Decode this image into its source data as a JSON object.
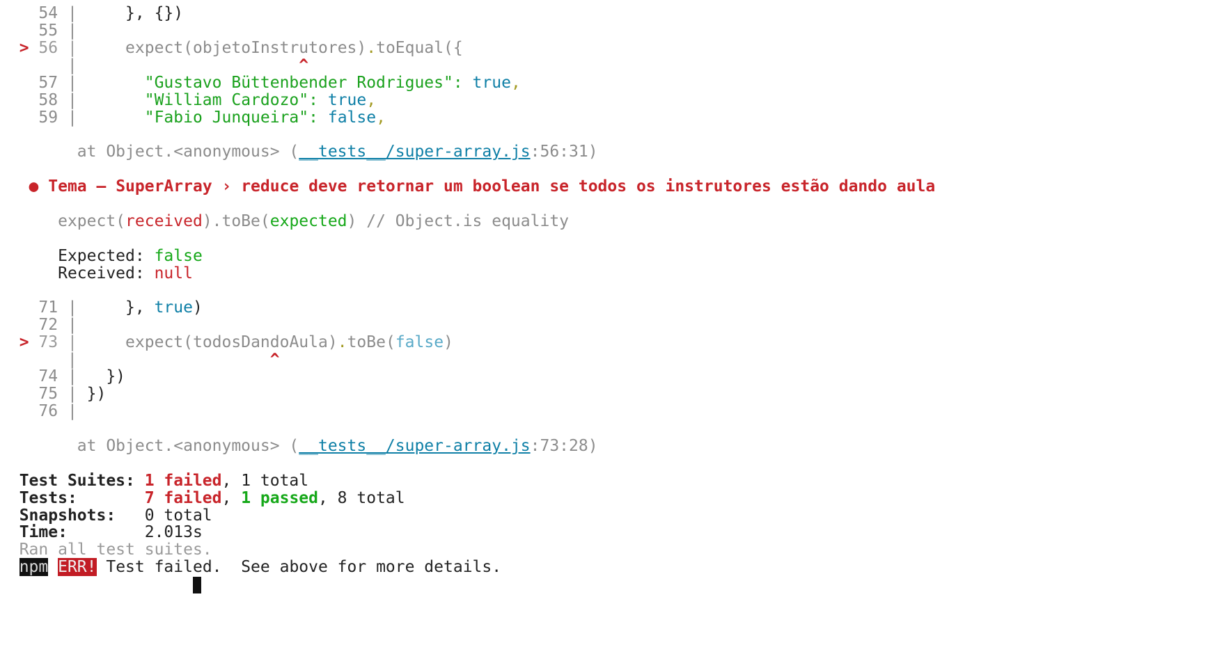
{
  "frame1": {
    "rows": [
      {
        "num": "54",
        "code": "    }, {})"
      },
      {
        "num": "55",
        "code": ""
      },
      {
        "marker": ">",
        "num": "56",
        "code_pre": "    expect(objetoInstrutores)",
        "dot": ".",
        "method": "toEqual({"
      },
      {
        "caret": "^"
      },
      {
        "num": "57",
        "key": "\"Gustavo Büttenbender Rodrigues\"",
        "colon": ":",
        "value": "true",
        "comma": ","
      },
      {
        "num": "58",
        "key": "\"William Cardozo\"",
        "colon": ":",
        "value": "true",
        "comma": ","
      },
      {
        "num": "59",
        "key": "\"Fabio Junqueira\"",
        "colon": ":",
        "value": "false",
        "comma": ","
      }
    ],
    "location": {
      "prefix": "at Object.<anonymous> (",
      "path": "__tests__/super-array.js",
      "suffix": ":56:31)"
    }
  },
  "failure2": {
    "bullet": "●",
    "title": "Tema – SuperArray › reduce deve retornar um boolean se todos os instrutores estão dando aula",
    "matcher": {
      "expect_word": "expect(",
      "received": "received",
      "mid": ").toBe(",
      "expected": "expected",
      "end": ") // Object.is equality"
    },
    "expected_label": "Expected: ",
    "expected_value": "false",
    "received_label": "Received: ",
    "received_value": "null",
    "rows": [
      {
        "num": "71",
        "code_pre": "    }, ",
        "value": "true",
        "code_post": ")"
      },
      {
        "num": "72",
        "code": ""
      },
      {
        "marker": ">",
        "num": "73",
        "code_pre": "    expect(todosDandoAula)",
        "dot": ".",
        "method": "toBe(",
        "arg": "false",
        "end": ")"
      },
      {
        "caret": "^"
      },
      {
        "num": "74",
        "code": "  })"
      },
      {
        "num": "75",
        "code": "})"
      },
      {
        "num": "76",
        "code": ""
      }
    ],
    "location": {
      "prefix": "at Object.<anonymous> (",
      "path": "__tests__/super-array.js",
      "suffix": ":73:28)"
    }
  },
  "summary": {
    "suites_label": "Test Suites: ",
    "suites_failed": "1 failed",
    "suites_total": ", 1 total",
    "tests_label": "Tests:       ",
    "tests_failed": "7 failed",
    "tests_sep": ", ",
    "tests_passed": "1 passed",
    "tests_total": ", 8 total",
    "snapshots_label": "Snapshots:   ",
    "snapshots_value": "0 total",
    "time_label": "Time:        ",
    "time_value": "2.013s",
    "ran": "Ran all test suites."
  },
  "npm_error": {
    "npm": "npm",
    "err": "ERR!",
    "message": " Test failed.  See above for more details."
  },
  "colors": {
    "error_red": "#c8242a",
    "pass_green": "#16a819",
    "path_cyan": "#0e7fa6",
    "bool_cyan": "#0e7fa6"
  }
}
